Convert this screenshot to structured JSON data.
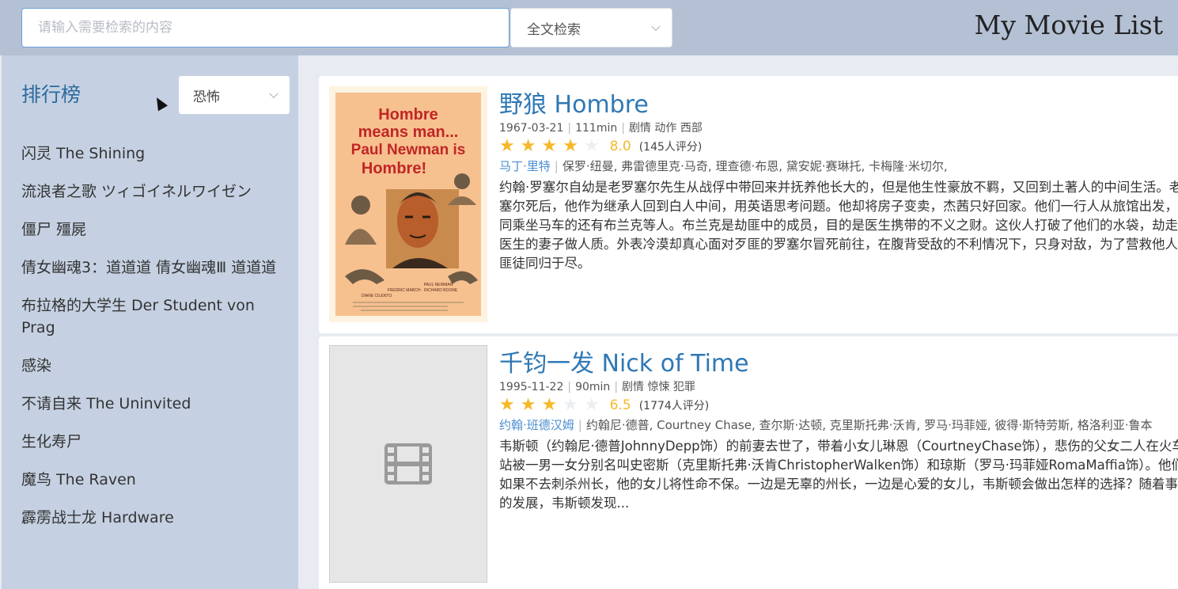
{
  "app": {
    "title": "My Movie List"
  },
  "search": {
    "placeholder": "请输入需要检索的内容",
    "value": "",
    "mode": "全文检索"
  },
  "sidebar": {
    "title": "排行榜",
    "genre": "恐怖",
    "items": [
      "闪灵 The Shining",
      "流浪者之歌 ツィゴイネルワイゼン",
      "僵尸 殭屍",
      "倩女幽魂3：道道道 倩女幽魂Ⅲ 道道道",
      "布拉格的大学生 Der Student von Prag",
      "感染",
      "不请自来 The Uninvited",
      "生化寿尸",
      "魔鸟 The Raven",
      "霹雳战士龙 Hardware"
    ]
  },
  "movies": [
    {
      "title": "野狼 Hombre",
      "date": "1967-03-21",
      "runtime": "111min",
      "genres": "剧情 动作 西部",
      "stars": 4,
      "score": "8.0",
      "votes": "(145人评分)",
      "director": "马丁·里特",
      "cast": "保罗·纽曼, 弗雷德里克·马奇, 理查德·布恩, 黛安妮·赛琳托, 卡梅隆·米切尔,",
      "description": "约翰·罗塞尔自幼是老罗塞尔先生从战俘中带回来并抚养他长大的，但是他生性豪放不羁，又回到土著人的中间生活。老罗塞尔死后，他作为继承人回到白人中间，用英语思考问题。他却将房子变卖，杰茜只好回家。他们一行人从旅馆出发，一同乘坐马车的还有布兰克等人。布兰克是劫匪中的成员，目的是医生携带的不义之财。这伙人打破了他们的水袋，劫走了医生的妻子做人质。外表冷漠却真心面对歹匪的罗塞尔冒死前往，在腹背受敌的不利情况下，只身对敌，为了营救他人与匪徒同归于尽。",
      "poster": {
        "lines": [
          "Hombre",
          "means man...",
          "Paul Newman is",
          "Hombre!"
        ],
        "credits": "PAUL NEWMAN",
        "credits2": "FREDRIC MARCH · RICHARD BOONE",
        "credits3": "DIANE CILENTO"
      }
    },
    {
      "title": "千钧一发 Nick of Time",
      "date": "1995-11-22",
      "runtime": "90min",
      "genres": "剧情 惊悚 犯罪",
      "stars": 3,
      "score": "6.5",
      "votes": "(1774人评分)",
      "director": "约翰·班德汉姆",
      "cast": "约翰尼·德普, Courtney Chase, 查尔斯·达顿, 克里斯托弗·沃肯, 罗马·玛菲娅, 彼得·斯特劳斯, 格洛利亚·鲁本",
      "description": "韦斯顿（约翰尼·德普JohnnyDepp饰）的前妻去世了，带着小女儿琳恩（CourtneyChase饰），悲伤的父女二人在火车站被一男一女分别名叫史密斯（克里斯托弗·沃肯ChristopherWalken饰）和琼斯（罗马·玛菲娅RomaMaffia饰）。他们如果不去刺杀州长，他的女儿将性命不保。一边是无辜的州长，一边是心爱的女儿，韦斯顿会做出怎样的选择？随着事件的发展，韦斯顿发现..."
    }
  ],
  "colors": {
    "accent": "#2f78b5",
    "star": "#f5b829",
    "sidebar": "#c5d1e2",
    "topbar": "#b4c1d4"
  }
}
